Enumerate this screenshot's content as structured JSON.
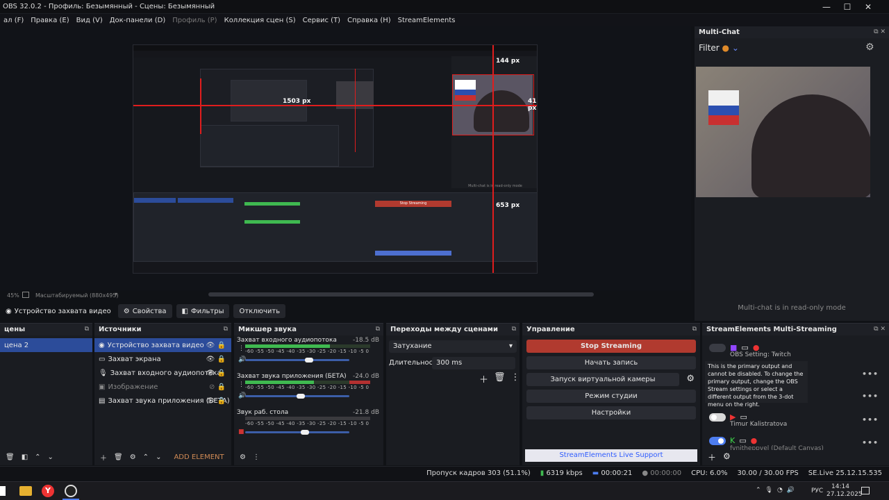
{
  "window": {
    "title": "OBS 32.0.2 - Профиль: Безымянный - Сцены: Безымянный",
    "min": "—",
    "max": "☐",
    "close": "✕"
  },
  "menu": [
    "Правка (E)",
    "Вид (V)",
    "Док-панели (D)",
    "Профиль (P)",
    "Коллекция сцен (S)",
    "Сервис (T)",
    "Справка (H)",
    "StreamElements"
  ],
  "menu_first": "ал (F)",
  "preview": {
    "label_1503": "1503 px",
    "label_144": "144 px",
    "label_41": "41 px",
    "label_653": "653 px",
    "inner_btn": "Stop Streaming",
    "inner_caption": "Multi-chat is in read-only mode"
  },
  "zoom": {
    "percent": "45%",
    "scale_mode": "Масштабируемый (880x495)"
  },
  "source_toolbar": {
    "source": "Устройство захвата видео",
    "props": "Свойства",
    "filters": "Фильтры",
    "disable": "Отключить"
  },
  "scenes": {
    "title": "цены",
    "items": [
      "цена 2"
    ]
  },
  "sources": {
    "title": "Источники",
    "items": [
      {
        "label": "Устройство захвата видео",
        "selected": true,
        "icon": "camera-icon",
        "visible": true
      },
      {
        "label": "Захват экрана",
        "selected": false,
        "icon": "monitor-icon",
        "visible": true
      },
      {
        "label": "Захват входного аудиопотока",
        "selected": false,
        "icon": "mic-icon",
        "visible": true
      },
      {
        "label": "Изображение",
        "selected": false,
        "icon": "image-icon",
        "visible": false
      },
      {
        "label": "Захват звука приложения (БЕТА)",
        "selected": false,
        "icon": "app-audio-icon",
        "visible": true
      }
    ],
    "add_element": "ADD ELEMENT"
  },
  "mixer": {
    "title": "Микшер звука",
    "scale": "-60 -55 -50 -45 -40 -35 -30 -25 -20 -15 -10 -5 0",
    "channels": [
      {
        "name": "Захват входного аудиопотока",
        "db": "-18.5 dB",
        "level": 0.68
      },
      {
        "name": "Захват звука приложения (БЕТА)",
        "db": "-24.0 dB",
        "level": 0.55
      },
      {
        "name": "Звук раб. стола",
        "db": "-21.8 dB",
        "level": 0.0
      }
    ]
  },
  "transitions": {
    "title": "Переходы между сценами",
    "type": "Затухание",
    "duration_label": "Длительность",
    "duration": "300 ms"
  },
  "controls": {
    "title": "Управление",
    "stop": "Stop Streaming",
    "record": "Начать запись",
    "virtual": "Запуск виртуальной камеры",
    "studio": "Режим студии",
    "settings": "Настройки",
    "support": "StreamElements Live Support"
  },
  "multichat": {
    "title": "Multi-Chat",
    "filter": "Filter",
    "footer": "Multi-chat is in read-only mode"
  },
  "multistream": {
    "title": "StreamElements Multi-Streaming",
    "twitch": "OBS Setting: Twitch",
    "tooltip": "This is the primary output and cannot be disabled. To change the primary output, change the OBS Stream settings or select a different output from the 3-dot menu on the right.",
    "youtube": "Timur Kalistratova",
    "kick": "fvnitheppvel (Default Canvas)"
  },
  "status": {
    "dropped": "Пропуск кадров 303 (51.1%)",
    "kbps": "6319 kbps",
    "stream_time": "00:00:21",
    "rec_time": "00:00:00",
    "cpu": "CPU: 6.0%",
    "fps": "30.00 / 30.00 FPS",
    "version": "SE.Live 25.12.15.535"
  },
  "taskbar": {
    "lang": "РУС",
    "time": "14:14",
    "date": "27.12.2025"
  },
  "colors": {
    "accent": "#2c4c9a",
    "stream_red": "#b13a2f",
    "guide_red": "#e01d1d"
  }
}
